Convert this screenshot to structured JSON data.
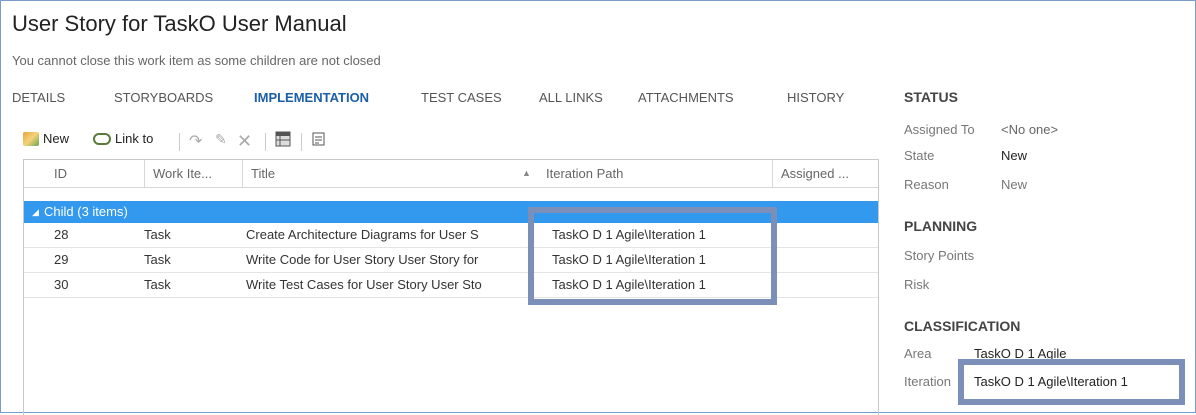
{
  "work_item": {
    "title": "User Story for TaskO User Manual",
    "warning": "You cannot close this work item as some children are not closed"
  },
  "tabs": [
    {
      "label": "DETAILS",
      "active": false
    },
    {
      "label": "STORYBOARDS",
      "active": false
    },
    {
      "label": "IMPLEMENTATION",
      "active": true
    },
    {
      "label": "TEST CASES",
      "active": false
    },
    {
      "label": "ALL LINKS",
      "active": false
    },
    {
      "label": "ATTACHMENTS",
      "active": false
    },
    {
      "label": "HISTORY",
      "active": false
    }
  ],
  "toolbar": {
    "new_label": "New",
    "link_label": "Link to",
    "icons": [
      "new-work-item-icon",
      "link-icon",
      "redo-icon",
      "edit-icon",
      "delete-icon",
      "open-in-excel-icon",
      "open-query-icon"
    ]
  },
  "grid": {
    "columns": [
      "ID",
      "Work Ite...",
      "Title",
      "Iteration Path",
      "Assigned ..."
    ],
    "group_label": "Child (3 items)",
    "rows": [
      {
        "id": "28",
        "type": "Task",
        "title": "Create Architecture Diagrams for User S",
        "iteration": "TaskO D 1 Agile\\Iteration 1"
      },
      {
        "id": "29",
        "type": "Task",
        "title": "Write Code for User Story User Story for",
        "iteration": "TaskO D 1 Agile\\Iteration 1"
      },
      {
        "id": "30",
        "type": "Task",
        "title": "Write Test Cases for User Story User Sto",
        "iteration": "TaskO D 1 Agile\\Iteration 1"
      }
    ]
  },
  "status": {
    "heading": "STATUS",
    "assigned_label": "Assigned To",
    "assigned_value": "<No one>",
    "state_label": "State",
    "state_value": "New",
    "reason_label": "Reason",
    "reason_value": "New"
  },
  "planning": {
    "heading": "PLANNING",
    "story_points_label": "Story Points",
    "risk_label": "Risk"
  },
  "classification": {
    "heading": "CLASSIFICATION",
    "area_label": "Area",
    "area_value": "TaskO D 1 Agile",
    "iteration_label": "Iteration",
    "iteration_value": "TaskO D 1 Agile\\Iteration 1"
  },
  "colors": {
    "accent": "#1a5fa8",
    "group_row": "#3399ee",
    "highlight_box": "#7b8fb8"
  }
}
